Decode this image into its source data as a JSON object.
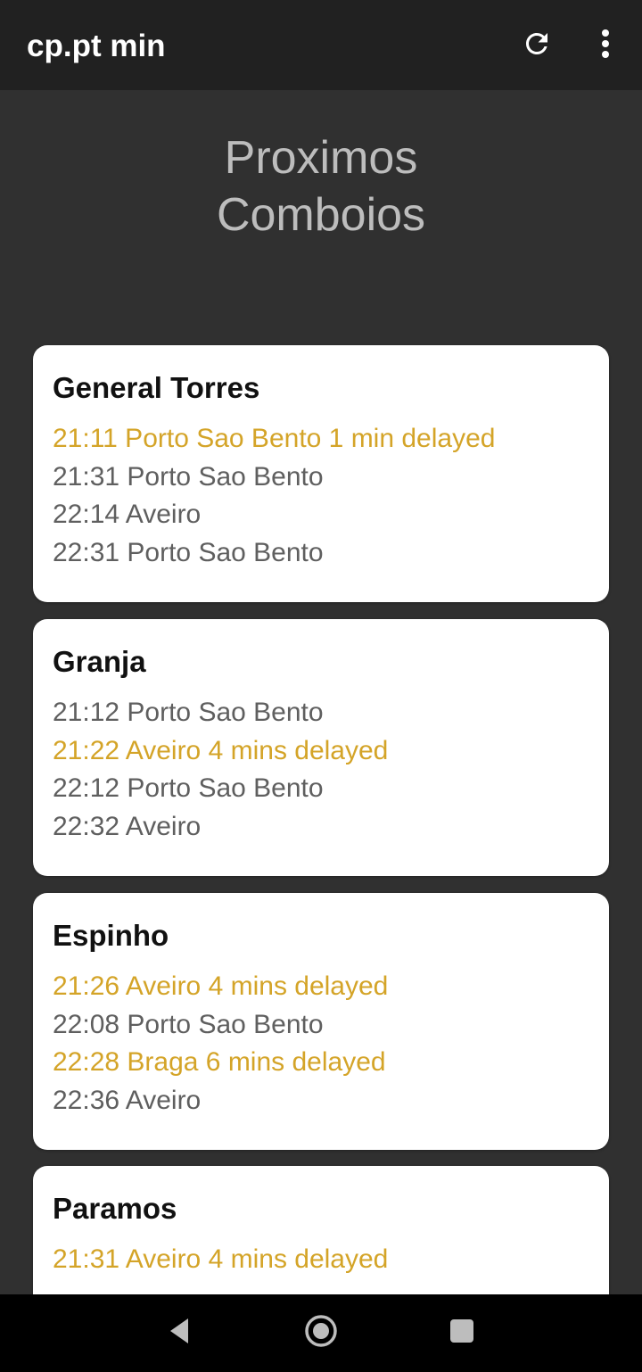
{
  "app_bar": {
    "title": "cp.pt min",
    "refresh_icon": "refresh-icon",
    "menu_icon": "more-vert-icon"
  },
  "page": {
    "title_line1": "Proximos",
    "title_line2": "Comboios"
  },
  "colors": {
    "app_bar": "#212121",
    "background": "#303030",
    "card": "#ffffff",
    "normal_text": "#5f5f5f",
    "delayed_text": "#d4a428"
  },
  "stations": [
    {
      "name": "General Torres",
      "departures": [
        {
          "text": "21:11 Porto Sao Bento  1 min delayed",
          "delayed": true
        },
        {
          "text": "21:31 Porto Sao Bento",
          "delayed": false
        },
        {
          "text": "22:14 Aveiro",
          "delayed": false
        },
        {
          "text": "22:31 Porto Sao Bento",
          "delayed": false
        }
      ]
    },
    {
      "name": "Granja",
      "departures": [
        {
          "text": "21:12 Porto Sao Bento",
          "delayed": false
        },
        {
          "text": "21:22 Aveiro  4 mins delayed",
          "delayed": true
        },
        {
          "text": "22:12 Porto Sao Bento",
          "delayed": false
        },
        {
          "text": "22:32 Aveiro",
          "delayed": false
        }
      ]
    },
    {
      "name": "Espinho",
      "departures": [
        {
          "text": "21:26 Aveiro  4 mins delayed",
          "delayed": true
        },
        {
          "text": "22:08 Porto Sao Bento",
          "delayed": false
        },
        {
          "text": "22:28 Braga  6 mins delayed",
          "delayed": true
        },
        {
          "text": "22:36 Aveiro",
          "delayed": false
        }
      ]
    },
    {
      "name": "Paramos",
      "departures": [
        {
          "text": "21:31 Aveiro  4 mins delayed",
          "delayed": true
        }
      ]
    }
  ],
  "nav_bar": {
    "back_icon": "back-triangle-icon",
    "home_icon": "home-circle-icon",
    "recents_icon": "recents-square-icon"
  }
}
